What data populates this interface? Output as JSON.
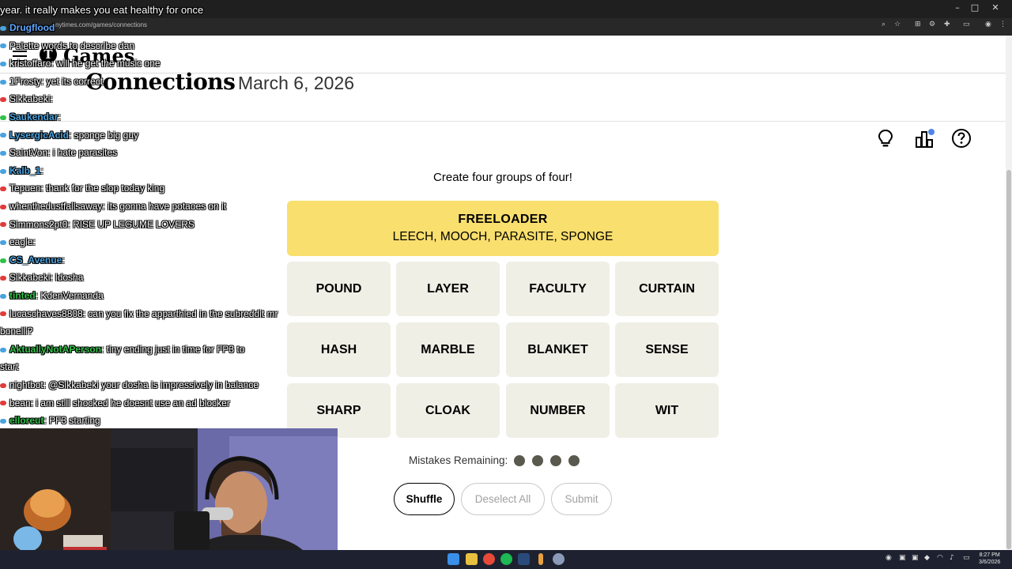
{
  "browser": {
    "url": "nytimes.com/games/connections",
    "window_controls": [
      "–",
      "□",
      "✕"
    ]
  },
  "header": {
    "brand_glyph": "T",
    "brand": "Games"
  },
  "game": {
    "title": "Connections",
    "date": "March 6, 2026",
    "instructions": "Create four groups of four!",
    "solved_group": {
      "category": "FREELOADER",
      "words": "LEECH, MOOCH, PARASITE, SPONGE",
      "color": "#f9df6d"
    },
    "tiles": [
      "POUND",
      "LAYER",
      "FACULTY",
      "CURTAIN",
      "HASH",
      "MARBLE",
      "BLANKET",
      "SENSE",
      "SHARP",
      "CLOAK",
      "NUMBER",
      "WIT"
    ],
    "mistakes_label": "Mistakes Remaining:",
    "mistakes_remaining": 4,
    "buttons": {
      "shuffle": "Shuffle",
      "deselect": "Deselect All",
      "submit": "Submit"
    }
  },
  "chat": {
    "top_line": "year. it really makes you eat healthy for once",
    "messages": [
      {
        "user": "Drugflood",
        "text": "",
        "color": "#5fa8ff",
        "badge": "#4aa3df"
      },
      {
        "user": "",
        "text": "Palette words to describe dan",
        "color": "#ffffff",
        "badge": "#4aa3df"
      },
      {
        "user": "",
        "text": "kristoffaro: will he get the music one",
        "color": "#ffffff",
        "badge": "#4aa3df"
      },
      {
        "user": "",
        "text": "1Frosty: yet its correct",
        "color": "#ffffff",
        "badge": "#4aa3df"
      },
      {
        "user": "",
        "text": "Sikkabeki:",
        "color": "#ffffff",
        "badge": "#e23b3b"
      },
      {
        "user": "Saukendar",
        "text": ":",
        "color": "#4aa3df",
        "badge": "#33c24a"
      },
      {
        "user": "LysergicAcid",
        "text": ": sponge  big guy",
        "color": "#4aa3df",
        "badge": "#4aa3df"
      },
      {
        "user": "",
        "text": "SaintVon:  i hate parasites",
        "color": "#ffffff",
        "badge": "#4aa3df"
      },
      {
        "user": "Kalb_1",
        "text": ":",
        "color": "#4aa3df",
        "badge": "#4aa3df"
      },
      {
        "user": "",
        "text": "Tepuen: thank for the slop today king",
        "color": "#ffffff",
        "badge": "#e23b3b"
      },
      {
        "user": "",
        "text": "whenthedustfallsaway: its gonna have potaoes on it",
        "color": "#ffffff",
        "badge": "#e23b3b"
      },
      {
        "user": "",
        "text": "Simmons2pt0: RISE UP LEGUME LOVERS",
        "color": "#ffffff",
        "badge": "#e23b3b"
      },
      {
        "user": "",
        "text": "eagle:",
        "color": "#ffffff",
        "badge": "#4aa3df"
      },
      {
        "user": "CS_Avenue",
        "text": ":",
        "color": "#4aa3df",
        "badge": "#33c24a"
      },
      {
        "user": "",
        "text": "Sikkabeki: ldosha",
        "color": "#ffffff",
        "badge": "#e23b3b"
      },
      {
        "user": "tinted",
        "text": ": KdenVernanda",
        "color": "#33c24a",
        "badge": "#4aa3df"
      },
      {
        "user": "",
        "text": "lucaschaves8808: can you fix the apparthied in the subreddit mr",
        "color": "#ffffff",
        "badge": "#e23b3b"
      },
      {
        "user": "",
        "text": "bonelli?",
        "color": "#ffffff",
        "badge": ""
      },
      {
        "user": "AktuallyNotAPerson",
        "text": ":  tiny ending just in time for FP3 to",
        "color": "#33c24a",
        "badge": "#4aa3df"
      },
      {
        "user": "",
        "text": "start",
        "color": "#ffffff",
        "badge": ""
      },
      {
        "user": "",
        "text": "nightbot: @Sikkabeki your dosha is impressively in balance",
        "color": "#ffffff",
        "badge": "#e23b3b"
      },
      {
        "user": "",
        "text": "bean: i am still shocked he doesnt use an ad blocker",
        "color": "#ffffff",
        "badge": "#e23b3b"
      },
      {
        "user": "elloreut",
        "text": ":  PF3 starting",
        "color": "#33c24a",
        "badge": "#4aa3df"
      }
    ]
  },
  "taskbar": {
    "clock_time": "8:27 PM",
    "clock_date": "3/6/2026"
  },
  "colors": {
    "tile_bg": "#efefe6",
    "dot": "#5a594e",
    "accent_badge": "#4f85e5"
  }
}
